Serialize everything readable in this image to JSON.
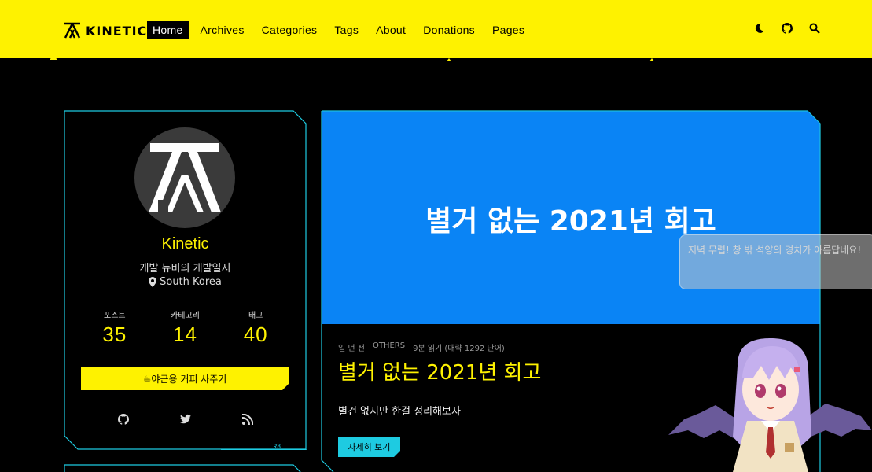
{
  "header": {
    "logo_text": "KINETIC",
    "nav": [
      {
        "label": "Home",
        "active": true
      },
      {
        "label": "Archives",
        "active": false
      },
      {
        "label": "Categories",
        "active": false
      },
      {
        "label": "Tags",
        "active": false
      },
      {
        "label": "About",
        "active": false
      },
      {
        "label": "Donations",
        "active": false
      },
      {
        "label": "Pages",
        "active": false
      }
    ],
    "icons": [
      "moon-icon",
      "github-icon",
      "search-icon"
    ]
  },
  "profile": {
    "name": "Kinetic",
    "bio": "개발 뉴비의 개발일지",
    "location": "South Korea",
    "stats": [
      {
        "label": "포스트",
        "value": "35"
      },
      {
        "label": "카테고리",
        "value": "14"
      },
      {
        "label": "태그",
        "value": "40"
      }
    ],
    "coffee_button": "☕야근용 커피 사주기",
    "socials": [
      "github-icon",
      "twitter-icon",
      "rss-icon"
    ],
    "corner_label": "R8"
  },
  "post": {
    "banner_title": "별거 없는 2021년 회고",
    "meta": {
      "date": "일 년 전",
      "category": "OTHERS",
      "reading": "9분 읽기 (대략 1292 단어)"
    },
    "title": "별거 없는 2021년 회고",
    "excerpt": "별건 없지만 한걸 정리해보자",
    "read_more": "자세히 보기"
  },
  "bubble": {
    "text": "저녁 무렵! 창 밖 석양의 경치가 아름답네요!"
  },
  "colors": {
    "accent": "#fef200",
    "cyan": "#1ecbe1",
    "banner": "#0a84f5",
    "background": "#000000"
  }
}
